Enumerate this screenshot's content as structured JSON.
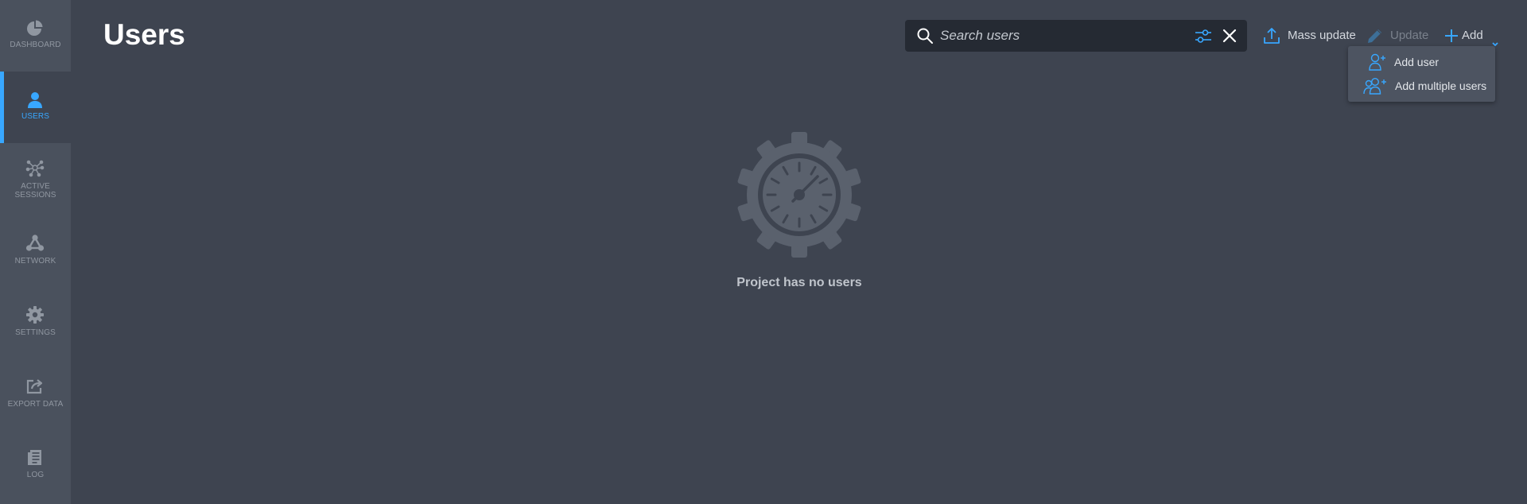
{
  "colors": {
    "accent": "#38a7ff",
    "background": "#3e4450",
    "sidebar": "#4a515d",
    "search_background": "#252a33"
  },
  "sidebar": {
    "items": [
      {
        "label": "DASHBOARD",
        "icon": "pie-chart-icon",
        "active": false
      },
      {
        "label": "USERS",
        "icon": "user-icon",
        "active": true
      },
      {
        "label": "ACTIVE\nSESSIONS",
        "icon": "network-nodes-icon",
        "active": false
      },
      {
        "label": "NETWORK",
        "icon": "network-icon",
        "active": false
      },
      {
        "label": "SETTINGS",
        "icon": "gear-icon",
        "active": false
      },
      {
        "label": "EXPORT DATA",
        "icon": "export-icon",
        "active": false
      },
      {
        "label": "LOG",
        "icon": "log-icon",
        "active": false
      }
    ]
  },
  "header": {
    "title": "Users"
  },
  "search": {
    "placeholder": "Search users",
    "value": ""
  },
  "toolbar": {
    "mass_update_label": "Mass update",
    "update_label": "Update",
    "add_label": "Add"
  },
  "add_menu": {
    "items": [
      {
        "label": "Add user",
        "icon": "add-user-icon"
      },
      {
        "label": "Add multiple users",
        "icon": "add-multiple-users-icon"
      }
    ]
  },
  "empty_state": {
    "message": "Project has no users",
    "icon": "gear-clock-icon"
  }
}
